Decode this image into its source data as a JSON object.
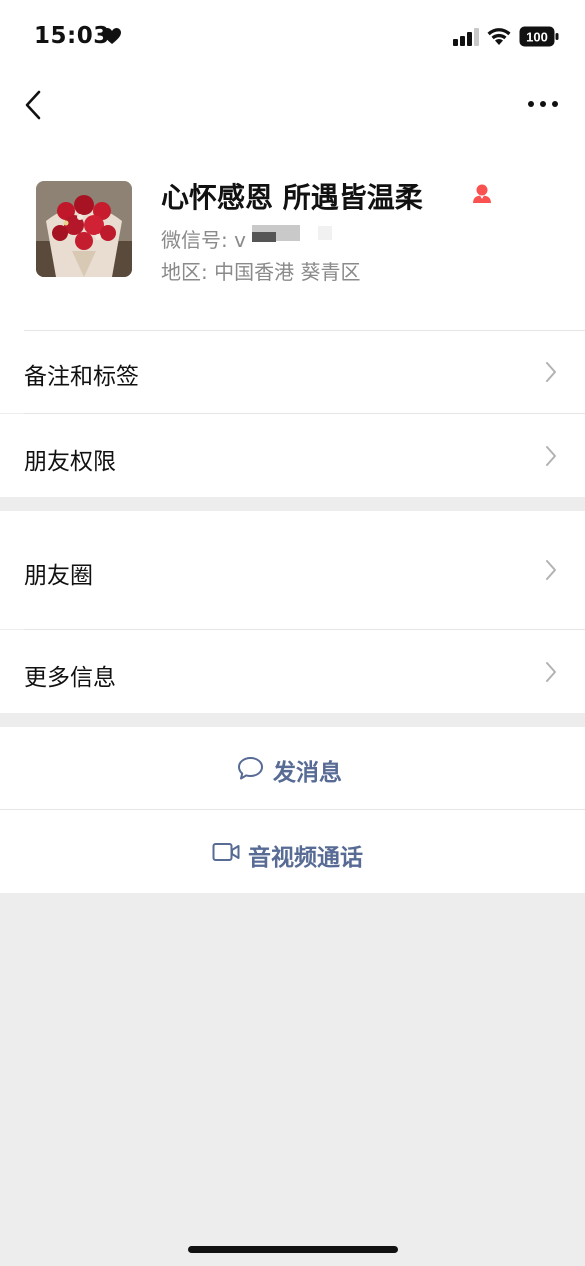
{
  "status_bar": {
    "time": "15:03",
    "battery": "100"
  },
  "nav": {
    "back_icon": "chevron-left-icon",
    "more_icon": "ellipsis-icon"
  },
  "profile": {
    "name": "心怀感恩 所遇皆温柔",
    "gender_icon": "female-person-icon",
    "gender_color": "#fa5151",
    "wechat_id_label": "微信号: v",
    "region_label": "地区: 中国香港 葵青区"
  },
  "menu": {
    "remark_tags": "备注和标签",
    "friend_permissions": "朋友权限",
    "moments": "朋友圈",
    "more_info": "更多信息"
  },
  "actions": {
    "send_message": "发消息",
    "video_call": "音视频通话"
  },
  "colors": {
    "link": "#576b95",
    "background": "#ededed",
    "card": "#ffffff"
  }
}
